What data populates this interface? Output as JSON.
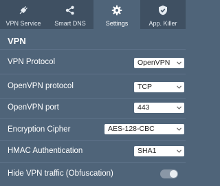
{
  "tabs": [
    {
      "label": "VPN Service",
      "icon": "plug-icon"
    },
    {
      "label": "Smart DNS",
      "icon": "share-icon"
    },
    {
      "label": "Settings",
      "icon": "gear-icon",
      "active": true
    },
    {
      "label": "App. Killer",
      "icon": "shield-icon"
    }
  ],
  "section": {
    "title": "VPN"
  },
  "rows": {
    "vpn_protocol": {
      "label": "VPN Protocol",
      "value": "OpenVPN"
    },
    "openvpn_protocol": {
      "label": "OpenVPN protocol",
      "value": "TCP"
    },
    "openvpn_port": {
      "label": "OpenVPN port",
      "value": "443"
    },
    "encryption_cipher": {
      "label": "Encryption Cipher",
      "value": "AES-128-CBC"
    },
    "hmac_auth": {
      "label": "HMAC Authentication",
      "value": "SHA1"
    },
    "hide_traffic": {
      "label": "Hide VPN traffic (Obfuscation)",
      "enabled": false
    }
  },
  "colors": {
    "background": "#4f6479",
    "tabbar": "#3f5062",
    "divider": "#5f738a"
  }
}
